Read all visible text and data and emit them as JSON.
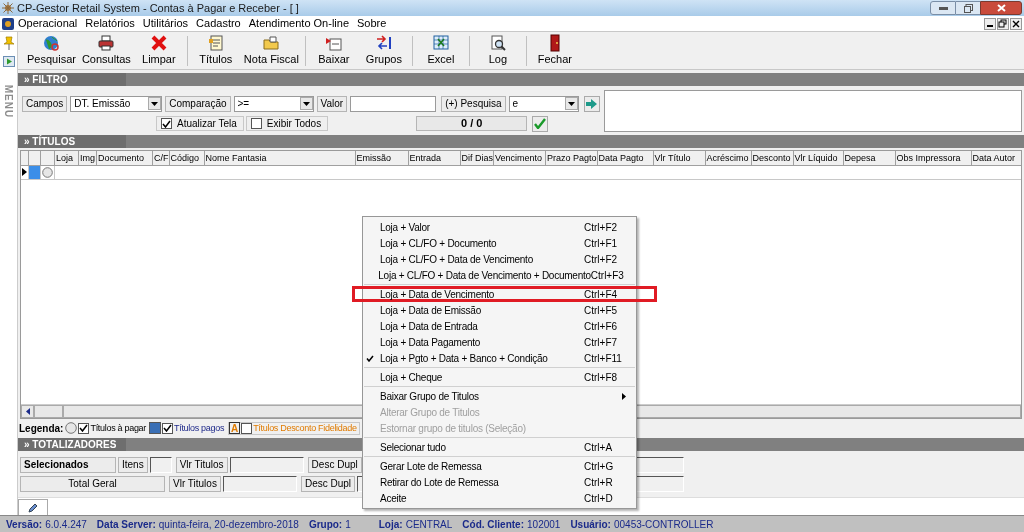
{
  "window": {
    "title": "CP-Gestor Retail System - Contas à Pagar e Receber - [ ]"
  },
  "menu_bar": [
    "Operacional",
    "Relatórios",
    "Utilitários",
    "Cadastro",
    "Atendimento On-line",
    "Sobre"
  ],
  "side_strip": {
    "label": "MENU"
  },
  "toolbar": [
    [
      "Pesquisar",
      "Consultas",
      "Limpar"
    ],
    [
      "Títulos",
      "Nota Fiscal"
    ],
    [
      "Baixar",
      "Grupos"
    ],
    [
      "Excel"
    ],
    [
      "Log"
    ],
    [
      "Fechar"
    ]
  ],
  "filter": {
    "title": "» FILTRO",
    "fields_label": "Campos",
    "field_value": "DT. Emissão",
    "comparison_label": "Comparação",
    "comparison_value": ">=",
    "value_label": "Valor",
    "search_label": "(+) Pesquisa",
    "search_value": "e",
    "checkboxes": [
      {
        "label": "Atualizar Tela",
        "checked": true
      },
      {
        "label": "Exibir Todos",
        "checked": false
      }
    ],
    "counter": "0 / 0"
  },
  "titles": {
    "title": "» TÍTULOS",
    "columns": [
      "Loja",
      "Img",
      "Documento",
      "C/F",
      "Código",
      "Nome Fantasia",
      "Emissão",
      "Entrada",
      "Dif Dias",
      "Vencimento",
      "Prazo Pagto",
      "Data Pagto",
      "Vlr Título",
      "Acréscimo",
      "Desconto",
      "Vlr Líquido",
      "Depesa",
      "Obs Impressora",
      "Data Autor"
    ],
    "rows": [
      {
        "current": true
      }
    ]
  },
  "legend": {
    "label": "Legenda:",
    "items": [
      {
        "kind": "radio",
        "label": "Títulos à pagar",
        "checked": true
      },
      {
        "kind": "square",
        "label": "Títulos pagos",
        "checked": true
      },
      {
        "kind": "letter",
        "badge": "A",
        "label": "Títulos Desconto Fidelidade",
        "checked": false
      }
    ]
  },
  "totals": {
    "title": "» TOTALIZADORES",
    "rows": [
      {
        "label": "Selecionados",
        "bold": true,
        "count_label": "Itens",
        "value_label": "Vlr Titulos",
        "discount_label": "Desc Dupl"
      },
      {
        "label": "Total Geral",
        "bold": false,
        "value_label": "Vlr Titulos",
        "discount_label": "Desc Dupl"
      }
    ]
  },
  "context_menu": [
    [
      {
        "label": "Loja + Valor",
        "shortcut": "Ctrl+F2",
        "checked": false,
        "disabled": false,
        "submenu": false,
        "highlighted": false
      },
      {
        "label": "Loja + CL/FO + Documento",
        "shortcut": "Ctrl+F1",
        "checked": false,
        "disabled": false,
        "submenu": false,
        "highlighted": false
      },
      {
        "label": "Loja + CL/FO + Data de Vencimento",
        "shortcut": "Ctrl+F2",
        "checked": false,
        "disabled": false,
        "submenu": false,
        "highlighted": false
      },
      {
        "label": "Loja + CL/FO + Data de Vencimento + Documento",
        "shortcut": "Ctrl+F3",
        "checked": false,
        "disabled": false,
        "submenu": false,
        "highlighted": false
      }
    ],
    [
      {
        "label": "Loja + Data de Vencimento",
        "shortcut": "Ctrl+F4",
        "checked": false,
        "disabled": false,
        "submenu": false,
        "highlighted": true
      },
      {
        "label": "Loja + Data de Emissão",
        "shortcut": "Ctrl+F5",
        "checked": false,
        "disabled": false,
        "submenu": false,
        "highlighted": false
      },
      {
        "label": "Loja + Data de Entrada",
        "shortcut": "Ctrl+F6",
        "checked": false,
        "disabled": false,
        "submenu": false,
        "highlighted": false
      },
      {
        "label": "Loja + Data Pagamento",
        "shortcut": "Ctrl+F7",
        "checked": false,
        "disabled": false,
        "submenu": false,
        "highlighted": false
      },
      {
        "label": "Loja + Pgto + Data + Banco + Condição",
        "shortcut": "Ctrl+F11",
        "checked": true,
        "disabled": false,
        "submenu": false,
        "highlighted": false
      }
    ],
    [
      {
        "label": "Loja + Cheque",
        "shortcut": "Ctrl+F8",
        "checked": false,
        "disabled": false,
        "submenu": false,
        "highlighted": false
      }
    ],
    [
      {
        "label": "Baixar Grupo de Titulos",
        "checked": false,
        "disabled": false,
        "submenu": true,
        "highlighted": false
      },
      {
        "label": "Alterar Grupo de Titulos",
        "checked": false,
        "disabled": true,
        "submenu": false,
        "highlighted": false
      },
      {
        "label": "Estornar grupo de titulos (Seleção)",
        "checked": false,
        "disabled": true,
        "submenu": false,
        "highlighted": false
      }
    ],
    [
      {
        "label": "Selecionar tudo",
        "shortcut": "Ctrl+A",
        "checked": false,
        "disabled": false,
        "submenu": false,
        "highlighted": false
      }
    ],
    [
      {
        "label": "Gerar Lote de Remessa",
        "shortcut": "Ctrl+G",
        "checked": false,
        "disabled": false,
        "submenu": false,
        "highlighted": false
      },
      {
        "label": "Retirar do Lote de Remessa",
        "shortcut": "Ctrl+R",
        "checked": false,
        "disabled": false,
        "submenu": false,
        "highlighted": false
      },
      {
        "label": "Aceite",
        "shortcut": "Ctrl+D",
        "checked": false,
        "disabled": false,
        "submenu": false,
        "highlighted": false
      }
    ]
  ],
  "status_bar": [
    {
      "label": "Versão:",
      "value": "6.0.4.247"
    },
    {
      "label": "Data Server:",
      "value": "quinta-feira, 20-dezembro-2018"
    },
    {
      "label": "Grupo:",
      "value": "1"
    },
    {
      "label": "Loja:",
      "value": "CENTRAL"
    },
    {
      "label": "Cód. Cliente:",
      "value": "102001"
    },
    {
      "label": "Usuário:",
      "value": "00453-CONTROLLER"
    }
  ]
}
